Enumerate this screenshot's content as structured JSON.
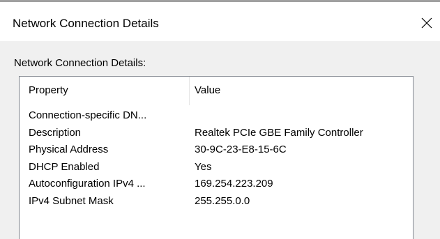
{
  "window": {
    "title": "Network Connection Details",
    "close_icon": "close-icon"
  },
  "group": {
    "label": "Network Connection Details:"
  },
  "table": {
    "columns": [
      "Property",
      "Value"
    ],
    "rows": [
      {
        "property": "Connection-specific DN...",
        "value": ""
      },
      {
        "property": "Description",
        "value": "Realtek PCIe GBE Family Controller"
      },
      {
        "property": "Physical Address",
        "value": "30-9C-23-E8-15-6C"
      },
      {
        "property": "DHCP Enabled",
        "value": "Yes"
      },
      {
        "property": "Autoconfiguration IPv4 ...",
        "value": "169.254.223.209"
      },
      {
        "property": "IPv4 Subnet Mask",
        "value": "255.255.0.0"
      }
    ]
  }
}
